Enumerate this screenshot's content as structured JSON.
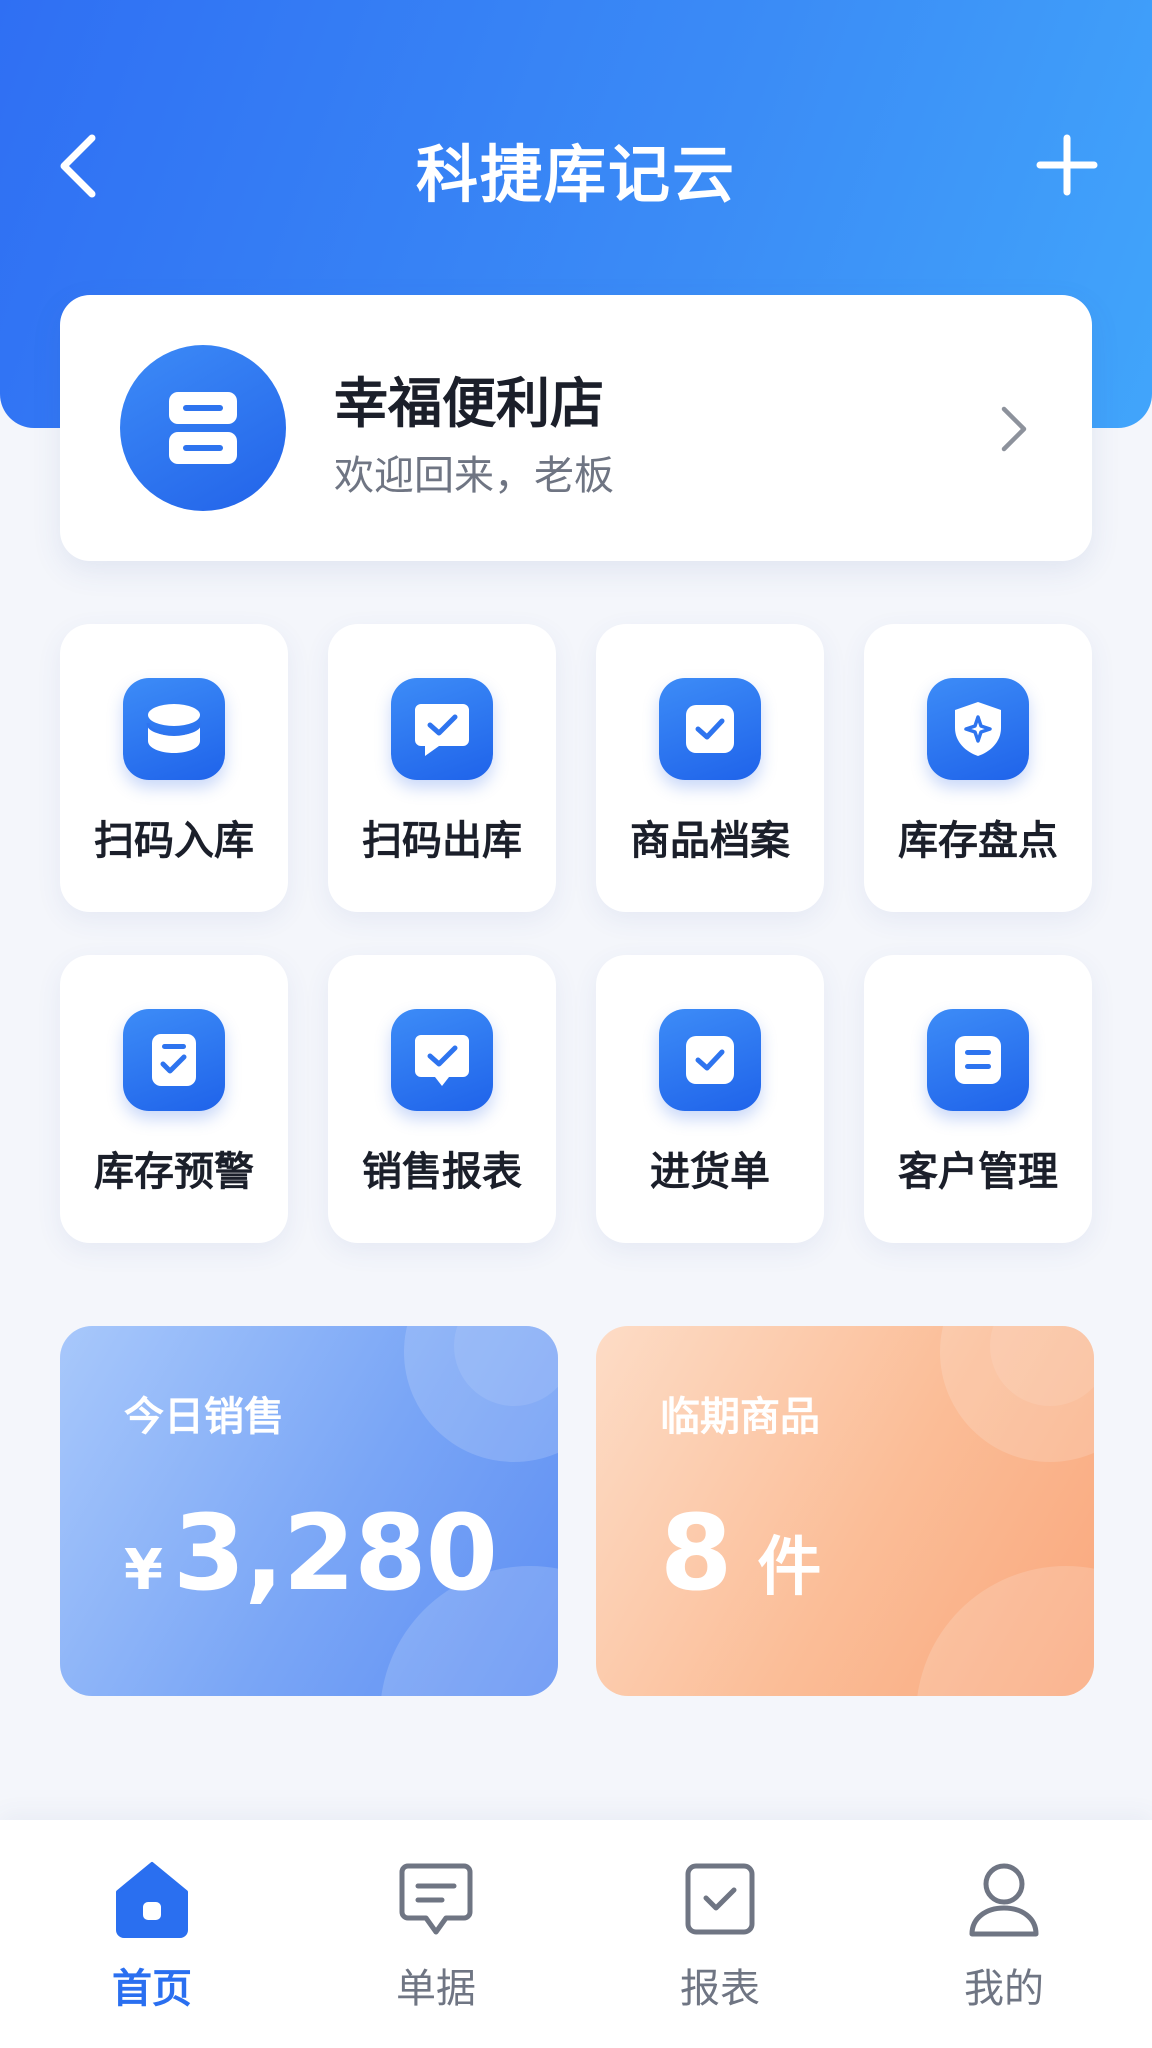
{
  "header": {
    "title": "科捷库记云",
    "back_icon": "chevron-left-icon",
    "add_icon": "plus-icon"
  },
  "store": {
    "name": "幸福便利店",
    "subtitle": "欢迎回来，老板",
    "icon": "store-icon"
  },
  "shortcuts": [
    {
      "label": "扫码入库",
      "icon": "database-icon"
    },
    {
      "label": "扫码出库",
      "icon": "chat-check-icon"
    },
    {
      "label": "商品档案",
      "icon": "checkbox-icon"
    },
    {
      "label": "库存盘点",
      "icon": "shield-icon"
    },
    {
      "label": "库存预警",
      "icon": "document-check-icon"
    },
    {
      "label": "销售报表",
      "icon": "chat-check-icon"
    },
    {
      "label": "进货单",
      "icon": "checkbox-icon"
    },
    {
      "label": "客户管理",
      "icon": "list-icon"
    }
  ],
  "stats": {
    "sales": {
      "title": "今日销售",
      "currency": "¥",
      "value": "3,280"
    },
    "expiry": {
      "title": "临期商品",
      "value": "8",
      "unit": "件"
    }
  },
  "tabs": [
    {
      "label": "首页",
      "icon": "home-icon",
      "active": true
    },
    {
      "label": "单据",
      "icon": "message-icon",
      "active": false
    },
    {
      "label": "报表",
      "icon": "report-check-icon",
      "active": false
    },
    {
      "label": "我的",
      "icon": "user-icon",
      "active": false
    }
  ],
  "colors": {
    "primary": "#2a6ff0",
    "header_gradient_start": "#2f6ff3",
    "header_gradient_end": "#41a5fb",
    "sales_card": "#7aa6f6",
    "expiry_card": "#fbbd97",
    "inactive_text": "#6f7583"
  }
}
